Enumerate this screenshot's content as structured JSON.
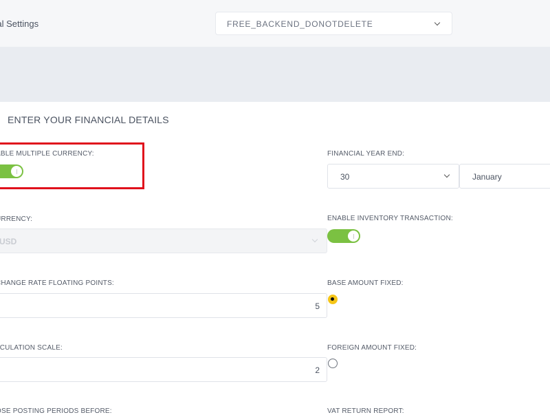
{
  "header": {
    "title": "cial Settings",
    "company_select": "FREE_BACKEND_DONOTDELETE"
  },
  "section": {
    "title": "ENTER YOUR FINANCIAL DETAILS"
  },
  "left": {
    "multi_currency_label": "ABLE MULTIPLE CURRENCY:",
    "multi_currency_on": true,
    "currency_label": "URRENCY:",
    "currency_value": "USD",
    "exchange_label": "CHANGE RATE FLOATING POINTS:",
    "exchange_value": "5",
    "calc_label": "LCULATION SCALE:",
    "calc_value": "2",
    "close_label": "OSE POSTING PERIODS BEFORE:"
  },
  "right": {
    "fy_end_label": "FINANCIAL YEAR END:",
    "fy_day": "30",
    "fy_month": "January",
    "inventory_label": "ENABLE INVENTORY TRANSACTION:",
    "inventory_on": true,
    "base_amount_label": "BASE AMOUNT FIXED:",
    "base_amount_checked": true,
    "foreign_amount_label": "FOREIGN AMOUNT FIXED:",
    "foreign_amount_checked": false,
    "vat_label": "VAT RETURN REPORT:"
  },
  "colors": {
    "toggle_on": "#7bc142",
    "radio_checked": "#f5c518",
    "highlight": "#e0101c"
  }
}
